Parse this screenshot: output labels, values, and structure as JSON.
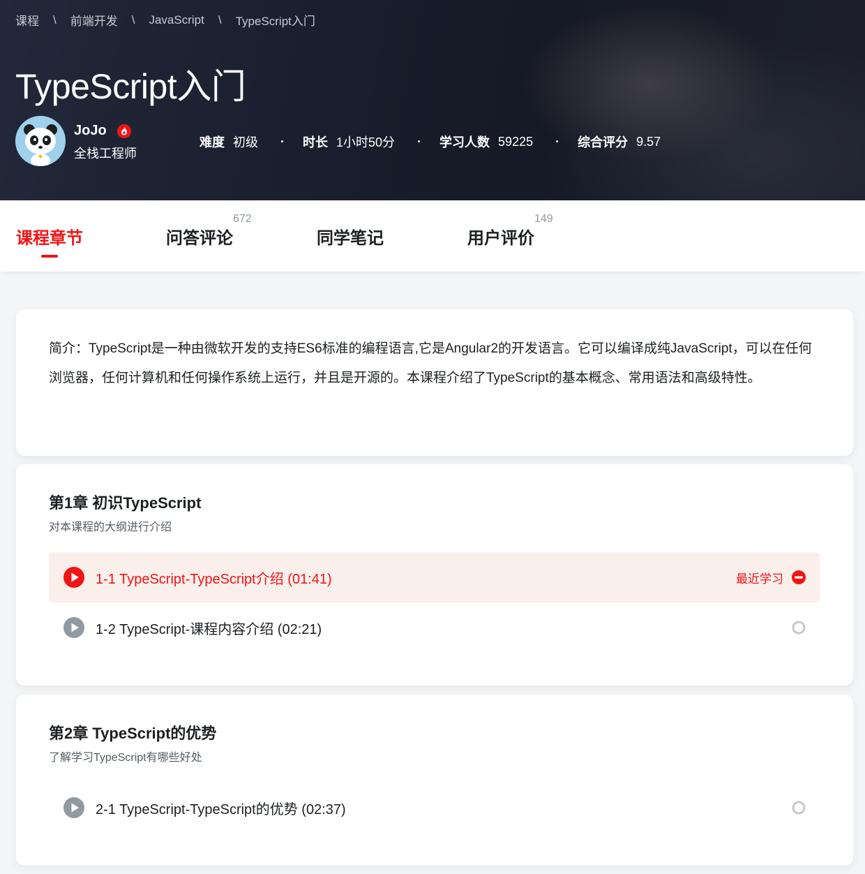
{
  "breadcrumb": [
    "课程",
    "前端开发",
    "JavaScript",
    "TypeScript入门"
  ],
  "breadcrumb_separator": "\\",
  "course": {
    "title": "TypeScript入门",
    "teacher": {
      "name": "JoJo",
      "title": "全栈工程师",
      "badge_icon": "flame-icon"
    },
    "stats": [
      {
        "label": "难度",
        "value": "初级"
      },
      {
        "label": "时长",
        "value": "1小时50分"
      },
      {
        "label": "学习人数",
        "value": "59225"
      },
      {
        "label": "综合评分",
        "value": "9.57"
      }
    ]
  },
  "tabs": [
    {
      "label": "课程章节",
      "count": "",
      "active": true
    },
    {
      "label": "问答评论",
      "count": "672",
      "active": false
    },
    {
      "label": "同学笔记",
      "count": "",
      "active": false
    },
    {
      "label": "用户评价",
      "count": "149",
      "active": false
    }
  ],
  "intro": {
    "text": "简介：TypeScript是一种由微软开发的支持ES6标准的编程语言,它是Angular2的开发语言。它可以编译成纯JavaScript，可以在任何浏览器，任何计算机和任何操作系统上运行，并且是开源的。本课程介绍了TypeScript的基本概念、常用语法和高级特性。"
  },
  "chapters": [
    {
      "title": "第1章 初识TypeScript",
      "desc": "对本课程的大纲进行介绍",
      "lessons": [
        {
          "title": "1-1 TypeScript-TypeScript介绍 (01:41)",
          "recent_label": "最近学习",
          "status": "in-progress"
        },
        {
          "title": "1-2 TypeScript-课程内容介绍 (02:21)",
          "status": "not-started"
        }
      ]
    },
    {
      "title": "第2章 TypeScript的优势",
      "desc": "了解学习TypeScript有哪些好处",
      "lessons": [
        {
          "title": "2-1 TypeScript-TypeScript的优势 (02:37)",
          "status": "not-started"
        }
      ]
    }
  ],
  "colors": {
    "accent": "#f01414",
    "text": "#1c1f21",
    "muted": "#9199a1",
    "play_gray": "#9199a1"
  }
}
